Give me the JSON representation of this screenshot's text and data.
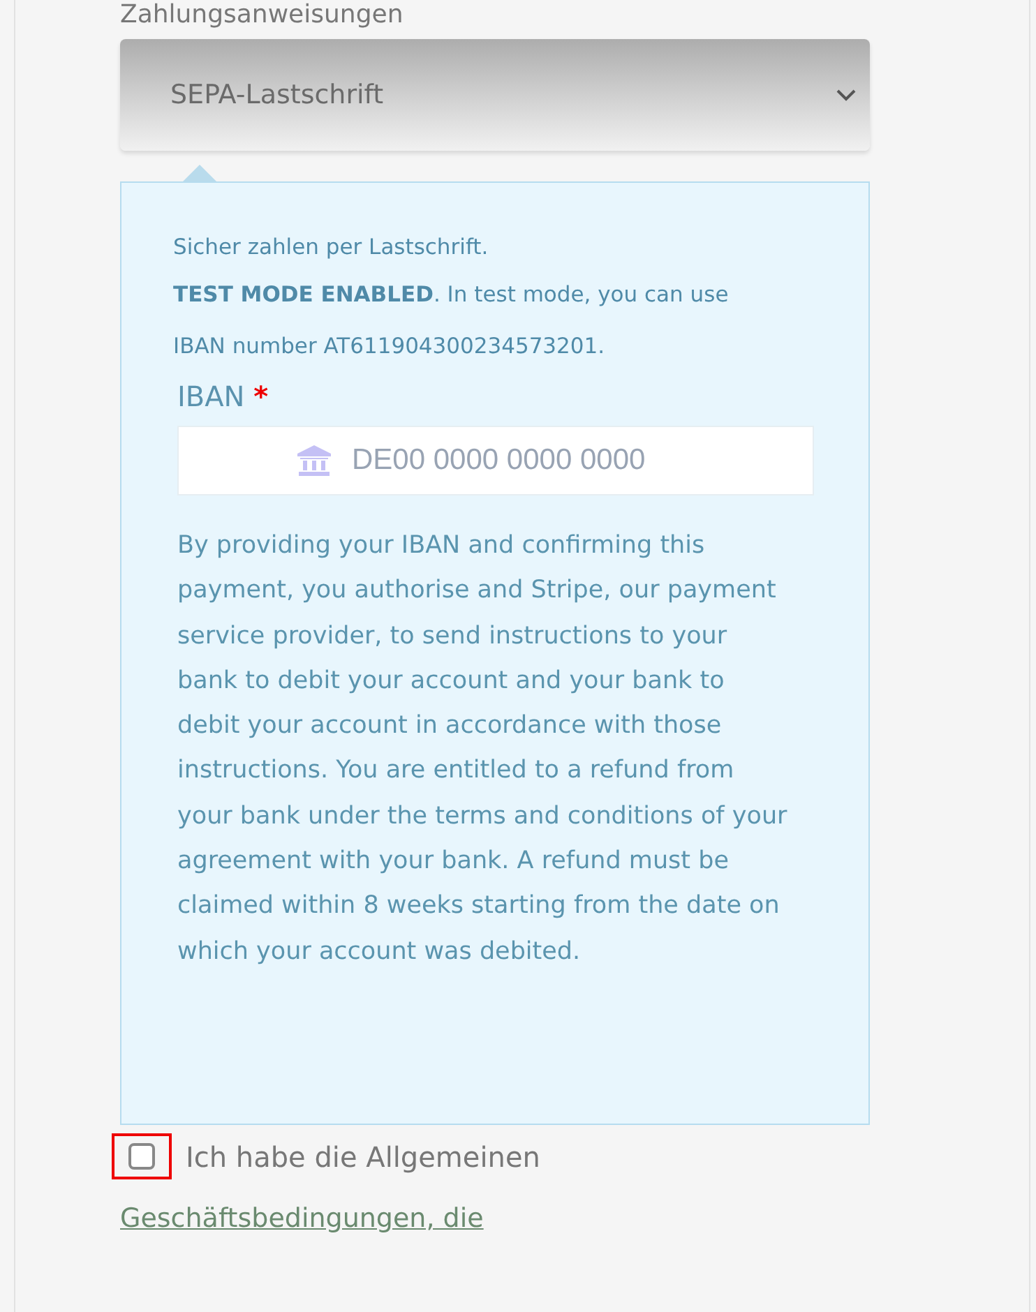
{
  "section_heading": "Zahlungsanweisungen",
  "payment_select": {
    "value": "SEPA-Lastschrift"
  },
  "info_box": {
    "intro": "Sicher zahlen per Lastschrift.",
    "test_mode": "**TEST MODE ENABLED**. In test mode, you can use IBAN number AT611904300234573201.",
    "iban_label": "IBAN",
    "required_mark": "*",
    "iban_field": {
      "placeholder": "DE00 0000 0000 0000"
    },
    "mandate": "By providing your IBAN and confirming this payment, you authorise and Stripe, our payment service provider, to send instructions to your bank to debit your account and your bank to debit your account in accordance with those instructions. You are entitled to a refund from your bank under the terms and conditions of your agreement with your bank. A refund must be claimed within 8 weeks starting from the date on which your account was debited."
  },
  "terms": {
    "checked": false,
    "error": true,
    "label": "Ich habe die Allgemeinen",
    "link": "Geschäftsbedingungen, die"
  }
}
